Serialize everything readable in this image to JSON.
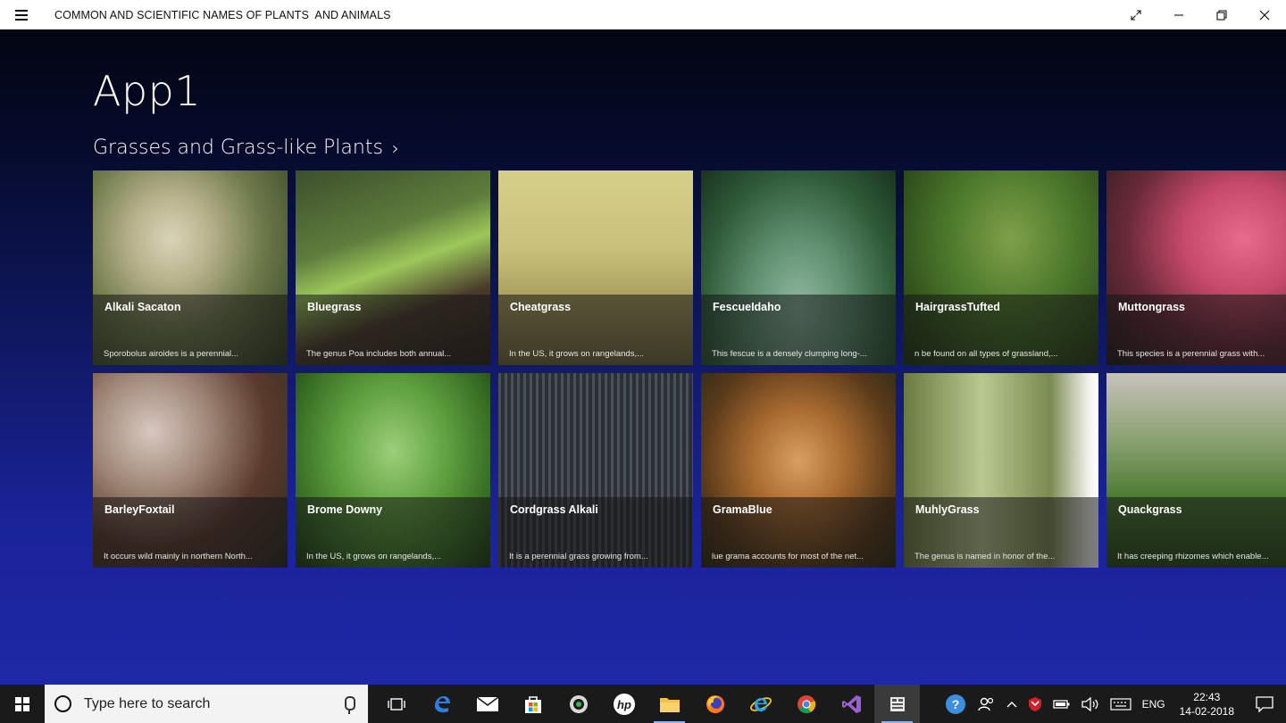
{
  "window": {
    "title": "COMMON AND SCIENTIFIC NAMES OF PLANTS  AND ANIMALS",
    "controls": {
      "fullscreen_icon": "expand-icon",
      "minimize_icon": "minimize-icon",
      "restore_icon": "restore-icon",
      "close_icon": "close-icon"
    }
  },
  "app": {
    "title": "App1",
    "section": {
      "label": "Grasses and Grass-like Plants",
      "chevron": "›"
    },
    "tiles": [
      {
        "name": "Alkali Sacaton",
        "desc": "Sporobolus airoides is a perennial..."
      },
      {
        "name": "Bluegrass",
        "desc": "The genus Poa includes both annual..."
      },
      {
        "name": "Cheatgrass",
        "desc": "In the US, it grows on rangelands,..."
      },
      {
        "name": "FescueIdaho",
        "desc": "This fescue is a densely clumping long-..."
      },
      {
        "name": "HairgrassTufted",
        "desc": "n be found on all types of grassland,..."
      },
      {
        "name": "Muttongrass",
        "desc": "This species is a perennial grass with..."
      },
      {
        "name": "BarleyFoxtail",
        "desc": "It occurs wild mainly in northern North..."
      },
      {
        "name": "Brome Downy",
        "desc": "In the US, it grows on rangelands,..."
      },
      {
        "name": "Cordgrass Alkali",
        "desc": "It is a perennial grass growing from..."
      },
      {
        "name": "GramaBlue",
        "desc": "lue grama accounts for most of the net..."
      },
      {
        "name": "MuhlyGrass",
        "desc": "The genus is named in honor of the..."
      },
      {
        "name": "Quackgrass",
        "desc": "It has creeping rhizomes which enable..."
      }
    ]
  },
  "taskbar": {
    "search_placeholder": "Type here to search",
    "apps": [
      "task-view-icon",
      "edge-icon",
      "mail-icon",
      "store-icon",
      "media-icon",
      "hp-icon",
      "file-explorer-icon",
      "firefox-icon",
      "internet-explorer-icon",
      "chrome-icon",
      "visual-studio-icon",
      "app1-icon"
    ],
    "tray": {
      "help_icon": "help-icon",
      "people_icon": "people-icon",
      "language": "ENG",
      "time": "22:43",
      "date": "14-02-2018"
    }
  }
}
